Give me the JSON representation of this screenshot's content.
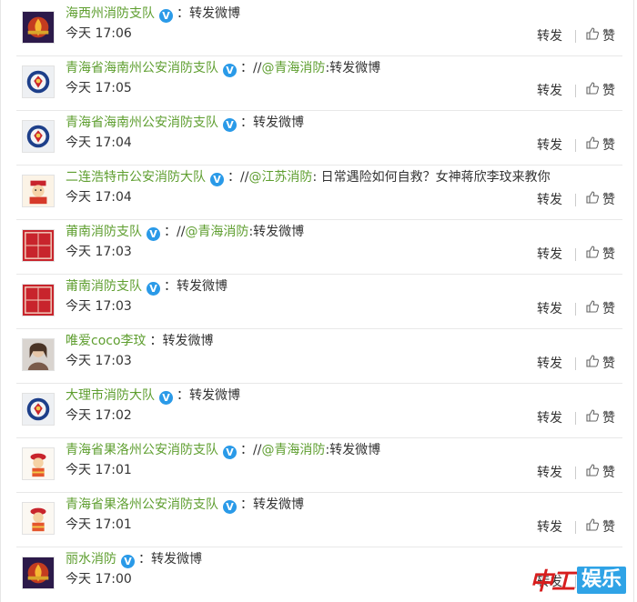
{
  "actions": {
    "forward_label": "转发",
    "like_label": "赞"
  },
  "posts": [
    {
      "user": "海西州消防支队",
      "sep": "：",
      "slashes": "",
      "mention": "",
      "text": "转发微博",
      "time": "今天 17:06",
      "avatar_icon": "fire-emblem-avatar"
    },
    {
      "user": "青海省海南州公安消防支队",
      "sep": "：",
      "slashes": "//",
      "mention": "@青海消防",
      "text": ":转发微博",
      "time": "今天 17:05",
      "avatar_icon": "police-badge-avatar"
    },
    {
      "user": "青海省海南州公安消防支队",
      "sep": "：",
      "slashes": "",
      "mention": "",
      "text": "转发微博",
      "time": "今天 17:04",
      "avatar_icon": "police-badge-avatar"
    },
    {
      "user": "二连浩特市公安消防大队",
      "sep": "：",
      "slashes": "//",
      "mention": "@江苏消防",
      "text": ": 日常遇险如何自救？女神蒋欣李玟来教你",
      "time": "今天 17:04",
      "avatar_icon": "firefighter-cartoon-avatar"
    },
    {
      "user": "莆南消防支队",
      "sep": "：",
      "slashes": "//",
      "mention": "@青海消防",
      "text": ":转发微博",
      "time": "今天 17:03",
      "avatar_icon": "red-seal-avatar"
    },
    {
      "user": "莆南消防支队",
      "sep": "：",
      "slashes": "",
      "mention": "",
      "text": "转发微博",
      "time": "今天 17:03",
      "avatar_icon": "red-seal-avatar"
    },
    {
      "user": "唯爱coco李玟",
      "sep": "：",
      "slashes": "",
      "mention": "",
      "text": "转发微博",
      "time": "今天 17:03",
      "avatar_icon": "portrait-avatar",
      "noV": true
    },
    {
      "user": "大理市消防大队",
      "sep": "：",
      "slashes": "",
      "mention": "",
      "text": "转发微博",
      "time": "今天 17:02",
      "avatar_icon": "police-badge-avatar"
    },
    {
      "user": "青海省果洛州公安消防支队",
      "sep": "：",
      "slashes": "//",
      "mention": "@青海消防",
      "text": ":转发微博",
      "time": "今天 17:01",
      "avatar_icon": "firefighter-mascot-avatar"
    },
    {
      "user": "青海省果洛州公安消防支队",
      "sep": "：",
      "slashes": "",
      "mention": "",
      "text": "转发微博",
      "time": "今天 17:01",
      "avatar_icon": "firefighter-mascot-avatar"
    },
    {
      "user": "丽水消防",
      "sep": "：",
      "slashes": "",
      "mention": "",
      "text": "转发微博",
      "time": "今天 17:00",
      "avatar_icon": "fire-emblem-avatar"
    }
  ],
  "watermark": {
    "logo": "中工",
    "badge": "娱乐"
  }
}
